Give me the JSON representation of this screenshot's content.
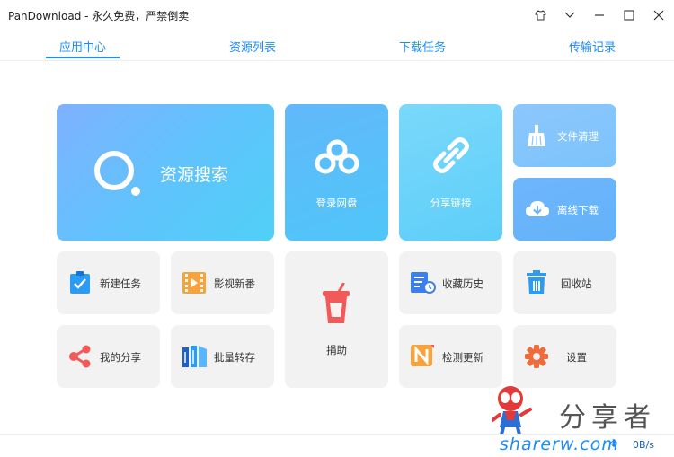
{
  "window": {
    "title": "PanDownload - 永久免费，严禁倒卖",
    "controls": [
      "skin-icon",
      "chevron-down-icon",
      "minimize-icon",
      "maximize-icon",
      "close-icon"
    ]
  },
  "tabs": [
    {
      "label": "应用中心",
      "active": true
    },
    {
      "label": "资源列表",
      "active": false
    },
    {
      "label": "下载任务",
      "active": false
    },
    {
      "label": "传输记录",
      "active": false
    }
  ],
  "tiles": {
    "search": "资源搜索",
    "login": "登录网盘",
    "share_link": "分享链接",
    "clean": "文件清理",
    "offline": "离线下载",
    "new_task": "新建任务",
    "video": "影视新番",
    "donate": "捐助",
    "history": "收藏历史",
    "recycle": "回收站",
    "my_share": "我的分享",
    "batch": "批量转存",
    "update": "检测更新",
    "settings": "设置"
  },
  "status": {
    "speed": "0B/s"
  },
  "watermark": {
    "text": "分享者",
    "url": "sharerw.com"
  },
  "colors": {
    "accent": "#1a8cff",
    "tile_gray": "#f2f2f2"
  }
}
